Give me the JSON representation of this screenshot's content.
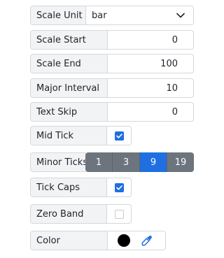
{
  "scale_unit": {
    "label": "Scale Unit",
    "value": "bar"
  },
  "scale_start": {
    "label": "Scale Start",
    "value": "0"
  },
  "scale_end": {
    "label": "Scale End",
    "value": "100"
  },
  "major_interval": {
    "label": "Major Interval",
    "value": "10"
  },
  "text_skip": {
    "label": "Text Skip",
    "value": "0"
  },
  "mid_tick": {
    "label": "Mid Tick",
    "checked": true
  },
  "minor_ticks": {
    "label": "Minor Ticks",
    "options": [
      "1",
      "3",
      "9",
      "19"
    ],
    "selected": "9"
  },
  "tick_caps": {
    "label": "Tick Caps",
    "checked": true
  },
  "zero_band": {
    "label": "Zero Band",
    "checked": false
  },
  "color": {
    "label": "Color",
    "value": "#000000",
    "icon": "eyedropper-icon"
  },
  "colors": {
    "accent": "#1f6fe0",
    "segment": "#6c757d"
  }
}
